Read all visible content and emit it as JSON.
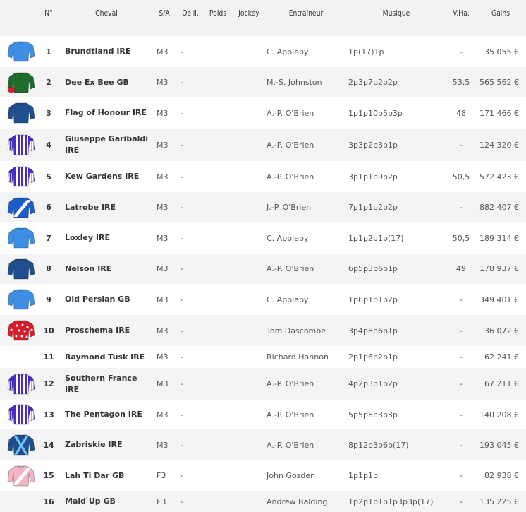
{
  "headers": {
    "num": "N°",
    "cheval": "Cheval",
    "sa": "S/A",
    "oeil": "Oeill.",
    "poids": "Poids",
    "jockey": "Jockey",
    "entraineur": "Entraîneur",
    "musique": "Musique",
    "vha": "V.Ha.",
    "gains": "Gains"
  },
  "rows": [
    {
      "num": "1",
      "cheval": "Brundtland IRE",
      "sa": "M3",
      "oeil": "-",
      "poids": "",
      "jockey": "",
      "entraineur": "C. Appleby",
      "musique": "1p(17)1p",
      "vha": "-",
      "gains": "35 055 €",
      "silk": {
        "icon": "godolphin-silk-icon",
        "body": "#3d8fe6",
        "accent": "#3d8fe6",
        "pattern": "plain"
      }
    },
    {
      "num": "2",
      "cheval": "Dee Ex Bee GB",
      "sa": "M3",
      "oeil": "-",
      "poids": "",
      "jockey": "",
      "entraineur": "M.-S. Johnston",
      "musique": "2p3p7p2p2p",
      "vha": "53,5",
      "gains": "565 562 €",
      "silk": {
        "icon": "green-red-cap-silk-icon",
        "body": "#1f6b2c",
        "accent": "#d3202a",
        "pattern": "cap"
      }
    },
    {
      "num": "3",
      "cheval": "Flag of Honour IRE",
      "sa": "M3",
      "oeil": "-",
      "poids": "",
      "jockey": "",
      "entraineur": "A.-P. O'Brien",
      "musique": "1p1p10p5p3p",
      "vha": "48",
      "gains": "171 466 €",
      "silk": {
        "icon": "dark-blue-silk-icon",
        "body": "#1f4f8f",
        "accent": "#1f4f8f",
        "pattern": "plain"
      }
    },
    {
      "num": "4",
      "cheval": "Giuseppe Garibaldi IRE",
      "sa": "M3",
      "oeil": "-",
      "poids": "",
      "jockey": "",
      "entraineur": "A.-P. O'Brien",
      "musique": "3p3p2p3p1p",
      "vha": "-",
      "gains": "124 320 €",
      "silk": {
        "icon": "purple-stripes-silk-icon",
        "body": "#4a2bc4",
        "accent": "#ffffff",
        "pattern": "stripes"
      }
    },
    {
      "num": "5",
      "cheval": "Kew Gardens IRE",
      "sa": "M3",
      "oeil": "-",
      "poids": "",
      "jockey": "",
      "entraineur": "A.-P. O'Brien",
      "musique": "3p1p1p9p2p",
      "vha": "50,5",
      "gains": "572 423 €",
      "silk": {
        "icon": "purple-stripes-silk-icon",
        "body": "#4a2bc4",
        "accent": "#ffffff",
        "pattern": "stripes"
      }
    },
    {
      "num": "6",
      "cheval": "Latrobe IRE",
      "sa": "M3",
      "oeil": "-",
      "poids": "",
      "jockey": "",
      "entraineur": "J.-P. O'Brien",
      "musique": "7p1p1p2p2p",
      "vha": "-",
      "gains": "882 407 €",
      "silk": {
        "icon": "blue-white-sash-silk-icon",
        "body": "#1d5cc8",
        "accent": "#ffffff",
        "pattern": "sash"
      }
    },
    {
      "num": "7",
      "cheval": "Loxley IRE",
      "sa": "M3",
      "oeil": "-",
      "poids": "",
      "jockey": "",
      "entraineur": "C. Appleby",
      "musique": "1p1p2p1p(17)",
      "vha": "50,5",
      "gains": "189 314 €",
      "silk": {
        "icon": "godolphin-silk-icon",
        "body": "#3d8fe6",
        "accent": "#3d8fe6",
        "pattern": "plain"
      }
    },
    {
      "num": "8",
      "cheval": "Nelson IRE",
      "sa": "M3",
      "oeil": "-",
      "poids": "",
      "jockey": "",
      "entraineur": "A.-P. O'Brien",
      "musique": "6p5p3p6p1p",
      "vha": "49",
      "gains": "178 937 €",
      "silk": {
        "icon": "dark-blue-silk-icon",
        "body": "#1f4f8f",
        "accent": "#1f4f8f",
        "pattern": "plain"
      }
    },
    {
      "num": "9",
      "cheval": "Old Persian GB",
      "sa": "M3",
      "oeil": "-",
      "poids": "",
      "jockey": "",
      "entraineur": "C. Appleby",
      "musique": "1p6p1p1p2p",
      "vha": "-",
      "gains": "349 401 €",
      "silk": {
        "icon": "godolphin-silk-icon",
        "body": "#3d8fe6",
        "accent": "#3d8fe6",
        "pattern": "plain"
      }
    },
    {
      "num": "10",
      "cheval": "Proschema IRE",
      "sa": "M3",
      "oeil": "-",
      "poids": "",
      "jockey": "",
      "entraineur": "Tom Dascombe",
      "musique": "3p4p8p6p1p",
      "vha": "-",
      "gains": "36 072 €",
      "silk": {
        "icon": "red-white-spots-silk-icon",
        "body": "#d61e2a",
        "accent": "#ffffff",
        "pattern": "spots"
      }
    },
    {
      "num": "11",
      "cheval": "Raymond Tusk IRE",
      "sa": "M3",
      "oeil": "-",
      "poids": "",
      "jockey": "",
      "entraineur": "Richard Hannon",
      "musique": "2p1p6p2p1p",
      "vha": "-",
      "gains": "62 241 €",
      "silk": null
    },
    {
      "num": "12",
      "cheval": "Southern France IRE",
      "sa": "M3",
      "oeil": "-",
      "poids": "",
      "jockey": "",
      "entraineur": "A.-P. O'Brien",
      "musique": "4p2p3p1p2p",
      "vha": "-",
      "gains": "67 211 €",
      "silk": {
        "icon": "purple-stripes-silk-icon",
        "body": "#4a2bc4",
        "accent": "#ffffff",
        "pattern": "stripes"
      }
    },
    {
      "num": "13",
      "cheval": "The Pentagon IRE",
      "sa": "M3",
      "oeil": "-",
      "poids": "",
      "jockey": "",
      "entraineur": "A.-P. O'Brien",
      "musique": "5p5p8p3p3p",
      "vha": "-",
      "gains": "140 208 €",
      "silk": {
        "icon": "purple-stripes-silk-icon",
        "body": "#4a2bc4",
        "accent": "#ffffff",
        "pattern": "stripes"
      }
    },
    {
      "num": "14",
      "cheval": "Zabriskie IRE",
      "sa": "M3",
      "oeil": "-",
      "poids": "",
      "jockey": "",
      "entraineur": "A.-P. O'Brien",
      "musique": "8p12p3p6p(17)",
      "vha": "-",
      "gains": "193 045 €",
      "silk": {
        "icon": "blue-crossbelts-silk-icon",
        "body": "#1f4f8f",
        "accent": "#6fc3f0",
        "pattern": "cross"
      }
    },
    {
      "num": "15",
      "cheval": "Lah Ti Dar GB",
      "sa": "F3",
      "oeil": "-",
      "poids": "",
      "jockey": "",
      "entraineur": "John Gosden",
      "musique": "1p1p1p",
      "vha": "-",
      "gains": "82 938 €",
      "silk": {
        "icon": "pink-sash-silk-icon",
        "body": "#f2b6c4",
        "accent": "#ffffff",
        "pattern": "sash"
      }
    },
    {
      "num": "16",
      "cheval": "Maid Up GB",
      "sa": "F3",
      "oeil": "-",
      "poids": "",
      "jockey": "",
      "entraineur": "Andrew Balding",
      "musique": "1p2p1p1p1p3p3p(17)",
      "vha": "-",
      "gains": "135 225 €",
      "silk": null
    }
  ]
}
